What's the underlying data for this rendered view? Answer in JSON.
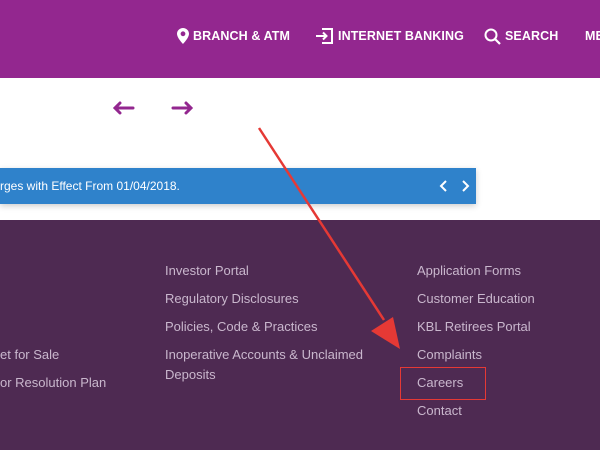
{
  "header": {
    "nav": {
      "branch_atm": "BRANCH & ATM",
      "internet_banking": "INTERNET BANKING",
      "search": "SEARCH",
      "more": "ME"
    }
  },
  "ticker": {
    "text": "rges with Effect From 01/04/2018."
  },
  "footer": {
    "col1": [
      "et for Sale",
      "or Resolution Plan"
    ],
    "col2": [
      "Investor Portal",
      "Regulatory Disclosures",
      "Policies, Code & Practices",
      "Inoperative Accounts & Unclaimed Deposits"
    ],
    "col3": [
      "Application Forms",
      "Customer Education",
      "KBL Retirees Portal",
      "Complaints",
      "Careers",
      "Contact"
    ]
  },
  "colors": {
    "header_bg": "#93278f",
    "ticker_bg": "#2f82cb",
    "footer_bg": "#4e2a52",
    "footer_link": "#c9b7cd",
    "annotation": "#e53935"
  }
}
